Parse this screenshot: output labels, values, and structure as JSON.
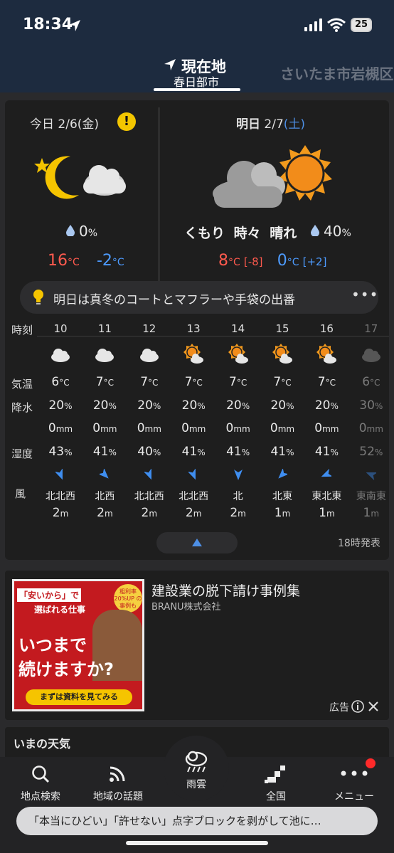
{
  "status_bar": {
    "time": "18:34",
    "battery": "25"
  },
  "header": {
    "current_label": "現在地",
    "current_city": "春日部市",
    "next_city": "さいたま市岩槻区"
  },
  "today": {
    "label": "今日",
    "date": "2/6",
    "weekday": "(金)",
    "alert_icon": "!",
    "weather_icon": "moon-cloud-icon",
    "precip": "0",
    "precip_unit": "%",
    "high": "16",
    "low": "-2",
    "temp_unit": "°C"
  },
  "tomorrow": {
    "label": "明日",
    "date": "2/7",
    "weekday": "(土)",
    "weather_icon": "cloud-sun-icon",
    "forecast": "くもり 時々 晴れ",
    "precip": "40",
    "precip_unit": "%",
    "high": "8",
    "high_diff": "[-8]",
    "low": "0",
    "low_diff": "[+2]",
    "temp_unit": "°C"
  },
  "tip": {
    "text": "明日は真冬のコートとマフラーや手袋の出番",
    "more": "•••"
  },
  "hourly_labels": {
    "time": "時刻",
    "temp": "気温",
    "precip_prob": "降水",
    "humidity": "湿度",
    "wind": "風"
  },
  "hourly": [
    {
      "hour": "10",
      "icon": "cloud-icon",
      "temp": "6",
      "prob": "20",
      "precip": "0",
      "humidity": "43",
      "wind_dir": "北北西",
      "wind_speed": "2"
    },
    {
      "hour": "11",
      "icon": "cloud-icon",
      "temp": "7",
      "prob": "20",
      "precip": "0",
      "humidity": "41",
      "wind_dir": "北西",
      "wind_speed": "2"
    },
    {
      "hour": "12",
      "icon": "cloud-icon",
      "temp": "7",
      "prob": "20",
      "precip": "0",
      "humidity": "40",
      "wind_dir": "北北西",
      "wind_speed": "2"
    },
    {
      "hour": "13",
      "icon": "sun-cloud-icon",
      "temp": "7",
      "prob": "20",
      "precip": "0",
      "humidity": "41",
      "wind_dir": "北北西",
      "wind_speed": "2"
    },
    {
      "hour": "14",
      "icon": "sun-cloud-icon",
      "temp": "7",
      "prob": "20",
      "precip": "0",
      "humidity": "41",
      "wind_dir": "北",
      "wind_speed": "2"
    },
    {
      "hour": "15",
      "icon": "sun-cloud-icon",
      "temp": "7",
      "prob": "20",
      "precip": "0",
      "humidity": "41",
      "wind_dir": "北東",
      "wind_speed": "1"
    },
    {
      "hour": "16",
      "icon": "sun-cloud-icon",
      "temp": "7",
      "prob": "20",
      "precip": "0",
      "humidity": "41",
      "wind_dir": "東北東",
      "wind_speed": "1"
    },
    {
      "hour": "17",
      "icon": "cloud-icon",
      "temp": "6",
      "prob": "30",
      "precip": "0",
      "humidity": "52",
      "wind_dir": "東南東",
      "wind_speed": "1"
    }
  ],
  "units": {
    "temp": "°C",
    "percent": "%",
    "mm": "mm",
    "speed": "m"
  },
  "issued": "18時発表",
  "ad": {
    "title": "建設業の脱下請け事例集",
    "advertiser": "BRANU株式会社",
    "img_line1": "「安いから」で",
    "img_line2": "選ばれる仕事",
    "img_line3": "いつまで",
    "img_line4": "続けますか?",
    "img_badge": "粗利率 20%UP の事例も",
    "img_cta": "まずは資料を見てみる",
    "label": "広告"
  },
  "now_section": {
    "title": "いまの天気"
  },
  "tabs": {
    "search": "地点検索",
    "topics": "地域の話題",
    "rain": "雨雲",
    "national": "全国",
    "menu": "メニュー"
  },
  "news": {
    "text": "「本当にひどい」「許せない」点字ブロックを剥がして池に…"
  },
  "colors": {
    "accent_blue": "#4d8fe6",
    "high_temp": "#ff5a4e",
    "low_temp": "#4d9bff",
    "header_bg": "#1d2b3f"
  }
}
